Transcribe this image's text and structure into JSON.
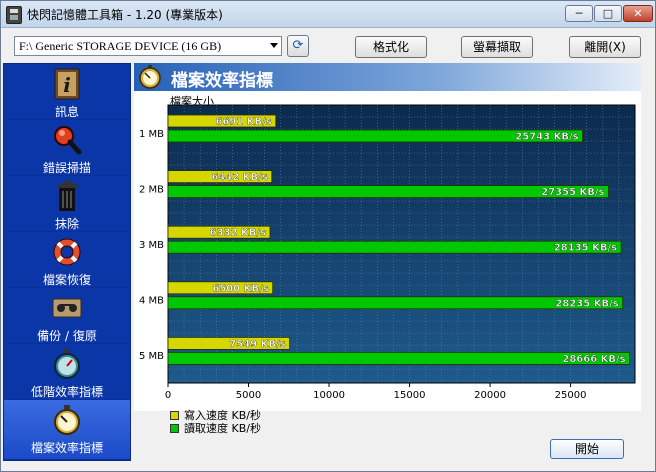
{
  "window": {
    "title": "快閃記憶體工具箱 - 1.20 (專業版本)",
    "min_glyph": "─",
    "max_glyph": "□",
    "close_glyph": "✕"
  },
  "toolbar": {
    "device_value": "F:\\ Generic STORAGE DEVICE (16 GB)",
    "format_label": "格式化",
    "capture_label": "螢幕擷取",
    "exit_label": "離開(X)",
    "refresh_glyph": "⟳"
  },
  "sidebar": {
    "items": [
      {
        "label": "訊息",
        "icon": "info-icon"
      },
      {
        "label": "錯誤掃描",
        "icon": "magnifier-icon"
      },
      {
        "label": "抹除",
        "icon": "trash-icon"
      },
      {
        "label": "檔案恢復",
        "icon": "lifebuoy-icon"
      },
      {
        "label": "備份 / 復原",
        "icon": "tape-icon"
      },
      {
        "label": "低階效率指標",
        "icon": "stopwatch-icon"
      },
      {
        "label": "檔案效率指標",
        "icon": "stopwatch-icon"
      }
    ]
  },
  "content": {
    "header_title": "檔案效率指標",
    "start_label": "開始"
  },
  "chart_data": {
    "type": "bar",
    "orientation": "horizontal",
    "title": "檔案大小",
    "categories": [
      "1 MB",
      "2 MB",
      "3 MB",
      "4 MB",
      "5 MB"
    ],
    "series": [
      {
        "name": "寫入速度 KB/秒",
        "color": "#d6d600",
        "values": [
          6691,
          6442,
          6332,
          6500,
          7549
        ],
        "labels": [
          "6691 KB/s",
          "6442 KB/s",
          "6332 KB/s",
          "6500 KB/s",
          "7549 KB/s"
        ]
      },
      {
        "name": "讀取速度 KB/秒",
        "color": "#00c800",
        "values": [
          25743,
          27355,
          28135,
          28235,
          28666
        ],
        "labels": [
          "25743 KB/s",
          "27355 KB/s",
          "28135 KB/s",
          "28235 KB/s",
          "28666 KB/s"
        ]
      }
    ],
    "xlim": [
      0,
      29000
    ],
    "xticks": [
      0,
      5000,
      10000,
      15000,
      20000,
      25000
    ],
    "xtick_labels": [
      "0",
      "5000",
      "10000",
      "15000",
      "20000",
      "25000"
    ],
    "grid": true,
    "legend_placement": "bottom-left"
  }
}
